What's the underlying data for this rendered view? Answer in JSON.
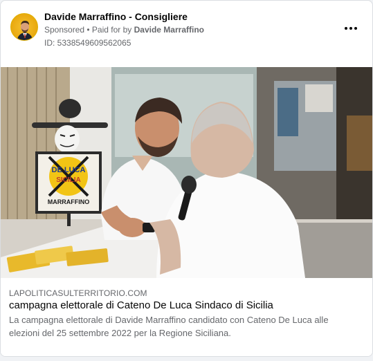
{
  "post": {
    "page_name": "Davide Marraffino - Consigliere",
    "sponsored_label": "Sponsored",
    "separator": " • ",
    "paid_for_prefix": "Paid for by ",
    "paid_for_name": "Davide Marraffino",
    "ad_id": "ID: 5338549609562065",
    "more_icon": "more-horizontal-icon"
  },
  "media": {
    "poster_line1": "DE LUCA",
    "poster_line2": "SICILIA",
    "poster_footer": "MARRAFFINO"
  },
  "link_preview": {
    "domain": "LAPOLITICASULTERRITORIO.COM",
    "title": "campagna elettorale di Cateno De Luca Sindaco di Sicilia",
    "description": "La campagna elettorale di Davide Marraffino candidato con Cateno De Luca alle elezioni del 25 settembre 2022 per la Regione Siciliana."
  },
  "colors": {
    "primary_text": "#050505",
    "secondary_text": "#65676b",
    "avatar_bg": "#f5c230"
  }
}
